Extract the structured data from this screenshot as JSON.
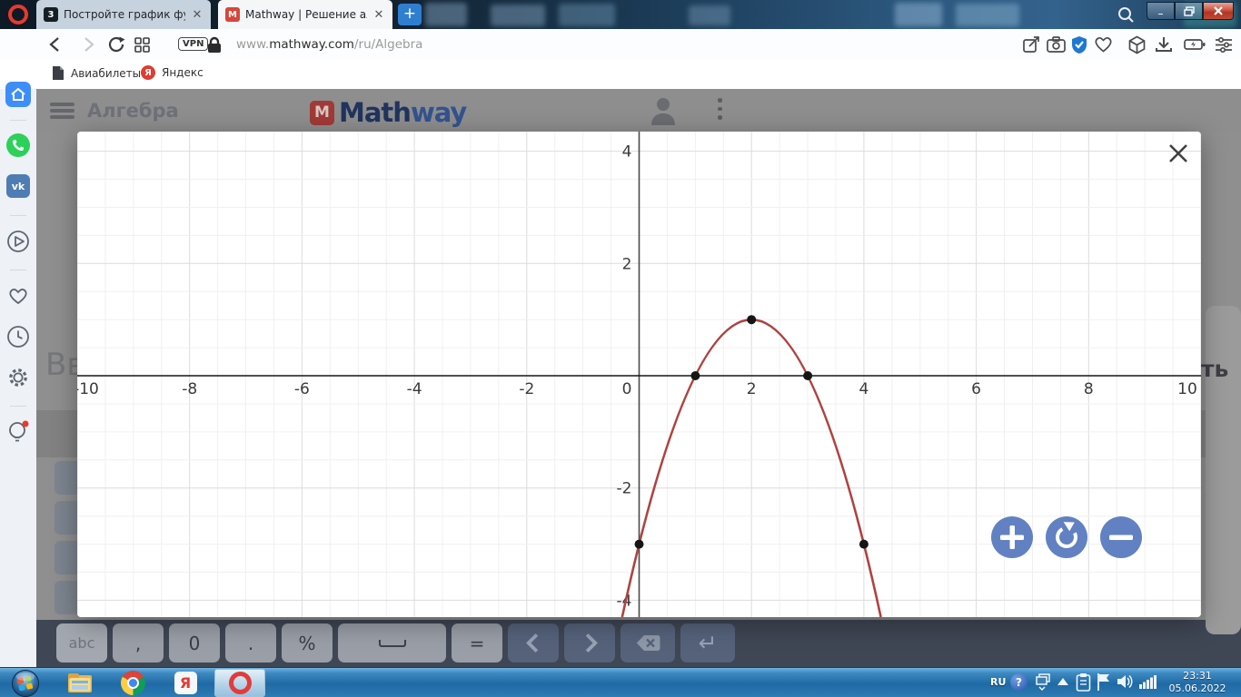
{
  "browser": {
    "tabs": [
      {
        "title": "Постройте график функци",
        "favicon_text": "3"
      },
      {
        "title": "Mathway | Решение алгеб",
        "favicon_text": "M"
      }
    ],
    "new_tab_label": "+",
    "window_controls": {
      "minimize": "–",
      "maximize": "",
      "close": ""
    },
    "address": {
      "vpn_badge": "VPN",
      "url_prefix": "www.",
      "url_domain": "mathway.com",
      "url_path": "/ru/Algebra"
    },
    "bookmarks": [
      {
        "label": "Авиабилеты"
      },
      {
        "label": "Яндекс",
        "badge": "Я"
      }
    ],
    "sidebar": {
      "vk_label": "vk"
    }
  },
  "mathway": {
    "menu_title": "Алгебра",
    "logo_mark": "M",
    "logo_text_1": "Math",
    "logo_text_2": "way"
  },
  "page_fragments": {
    "left_text": "Вв",
    "right_text": "ть"
  },
  "keyboard": {
    "keys": [
      {
        "name": "abc",
        "label": "abc",
        "variant": "muted",
        "type": "text"
      },
      {
        "name": "comma",
        "label": ",",
        "variant": "light",
        "type": "text"
      },
      {
        "name": "zero",
        "label": "0",
        "variant": "light",
        "type": "text"
      },
      {
        "name": "period",
        "label": ".",
        "variant": "light",
        "type": "text"
      },
      {
        "name": "percent",
        "label": "%",
        "variant": "light",
        "type": "text"
      },
      {
        "name": "space",
        "label": "",
        "variant": "light",
        "type": "space"
      },
      {
        "name": "equals",
        "label": "=",
        "variant": "light",
        "type": "text"
      },
      {
        "name": "prev",
        "label": "",
        "variant": "dark",
        "type": "chevron-left"
      },
      {
        "name": "next",
        "label": "",
        "variant": "dark",
        "type": "chevron-right"
      },
      {
        "name": "backspace",
        "label": "",
        "variant": "dark",
        "type": "backspace"
      },
      {
        "name": "enter",
        "label": "↵",
        "variant": "dark",
        "type": "text"
      }
    ]
  },
  "taskbar": {
    "language": "RU",
    "time": "23:31",
    "date": "05.06.2022",
    "yandex_badge": "Я"
  },
  "colors": {
    "curve": "#ae4340",
    "zoom_button": "#6181c2",
    "vpn_shield": "#1d78d2",
    "opera_red": "#e23b3b",
    "whatsapp_green": "#2bd158",
    "vk_blue": "#4f7db3",
    "home_blue": "#3e8ef7",
    "yandex_red": "#e03c31",
    "taskbar_blue": "#1f6aa5"
  },
  "chart_data": {
    "type": "line",
    "title": "",
    "xlabel": "",
    "ylabel": "",
    "function": "y = -(x-2)^2 + 1",
    "parabola": {
      "a": -1,
      "h": 2,
      "k": 1
    },
    "points": [
      [
        0,
        -3
      ],
      [
        1,
        0
      ],
      [
        2,
        1
      ],
      [
        3,
        0
      ],
      [
        4,
        -3
      ]
    ],
    "xlim": [
      -10,
      10
    ],
    "ylim": [
      -4.3,
      4.35
    ],
    "x_tick_step": 2,
    "y_tick_step": 2,
    "minor_grid_step": 0.5,
    "major_grid_step": 2,
    "grid": true,
    "legend": false,
    "curve_color": "#ae4340",
    "point_color": "#151515"
  }
}
